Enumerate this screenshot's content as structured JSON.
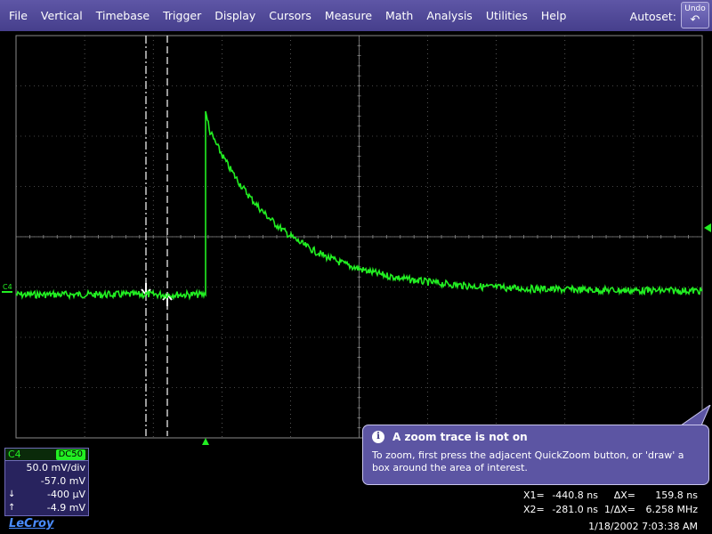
{
  "menu": {
    "items": [
      "File",
      "Vertical",
      "Timebase",
      "Trigger",
      "Display",
      "Cursors",
      "Measure",
      "Math",
      "Analysis",
      "Utilities",
      "Help"
    ],
    "autoset_label": "Autoset:",
    "undo_label": "Undo",
    "undo_icon": "undo-arrow-icon"
  },
  "grid": {
    "channel_marker": "C4",
    "trace_color": "#22ee22",
    "grid_color": "#8a8a8a"
  },
  "zoom_tooltip": {
    "title": "A zoom trace is not on",
    "body": "To zoom, first press the adjacent QuickZoom button, or 'draw' a box around the area of interest."
  },
  "channel_panel": {
    "name": "C4",
    "coupling": "DC50",
    "vdiv": "50.0 mV/div",
    "offset": "-57.0 mV",
    "cursor_down_value": "-400 µV",
    "cursor_up_value": "-4.9 mV"
  },
  "cursor_readout": {
    "x1_label": "X1=",
    "x1_value": "-440.8 ns",
    "dx_label": "ΔX=",
    "dx_value": "159.8 ns",
    "x2_label": "X2=",
    "x2_value": "-281.0 ns",
    "inv_dx_label": "1/ΔX=",
    "inv_dx_value": "6.258 MHz"
  },
  "footer": {
    "brand": "LeCroy",
    "timestamp": "1/18/2002 7:03:38 AM"
  }
}
